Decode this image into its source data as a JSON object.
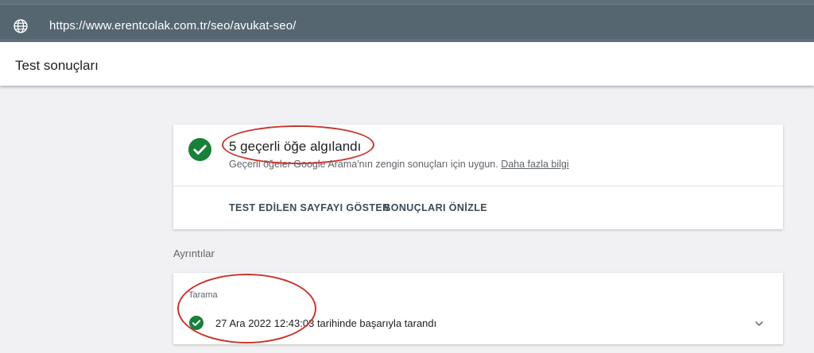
{
  "browser": {
    "url": "https://www.erentcolak.com.tr/seo/avukat-seo/",
    "globe_icon": "globe-icon"
  },
  "header": {
    "title": "Test sonuçları"
  },
  "result": {
    "title": "5 geçerli öğe algılandı",
    "subtitle": "Geçerli öğeler Google Arama'nın zengin sonuçları için uygun.",
    "link": "Daha fazla bilgi",
    "icon": "check-circle-icon",
    "actions": [
      {
        "label": "TEST EDİLEN SAYFAYI GÖSTER"
      },
      {
        "label": "SONUÇLARI ÖNİZLE"
      }
    ]
  },
  "details": {
    "label": "Ayrıntılar",
    "crawl": {
      "label": "Tarama",
      "text": "27 Ara 2022 12:43:03 tarihinde başarıyla tarandı",
      "icon": "check-circle-icon",
      "expand_icon": "chevron-down-icon"
    }
  },
  "colors": {
    "success": "#188038",
    "annotation": "#c8352b",
    "urlbar": "#566671"
  }
}
